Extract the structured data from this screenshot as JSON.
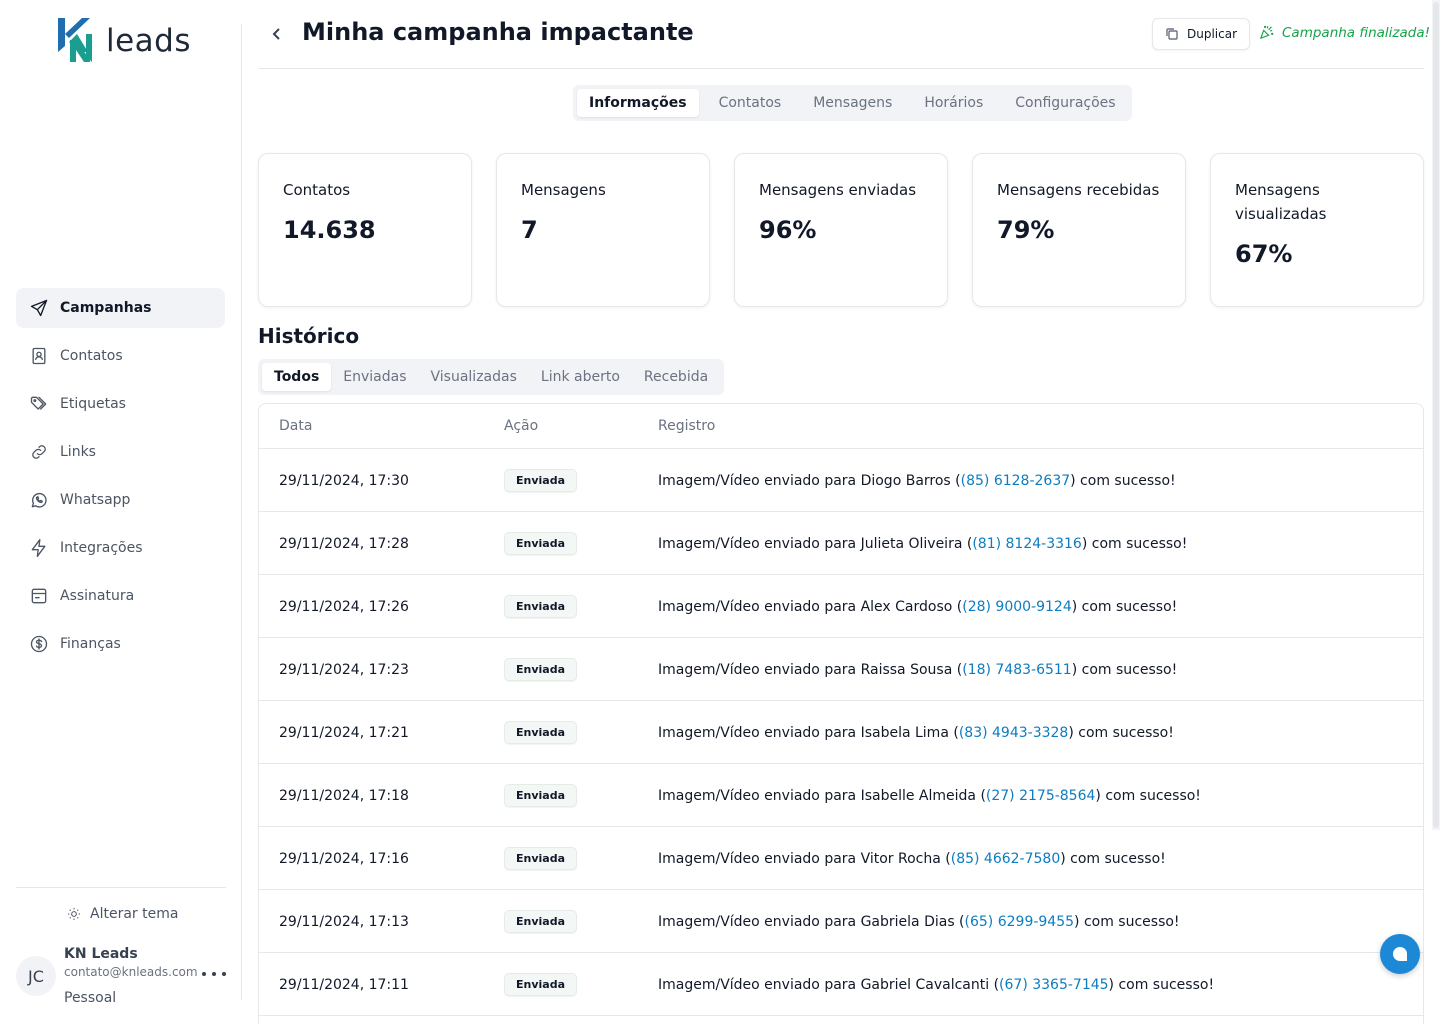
{
  "brand": {
    "logo_text": "leads"
  },
  "sidebar": {
    "items": [
      {
        "label": "Campanhas",
        "icon": "send-icon",
        "active": true
      },
      {
        "label": "Contatos",
        "icon": "contact-book-icon"
      },
      {
        "label": "Etiquetas",
        "icon": "tags-icon"
      },
      {
        "label": "Links",
        "icon": "link-icon"
      },
      {
        "label": "Whatsapp",
        "icon": "whatsapp-icon"
      },
      {
        "label": "Integrações",
        "icon": "zap-icon"
      },
      {
        "label": "Assinatura",
        "icon": "subscription-icon"
      },
      {
        "label": "Finanças",
        "icon": "dollar-icon"
      }
    ],
    "theme_toggle": "Alterar tema",
    "user": {
      "initials": "JC",
      "name": "KN Leads",
      "email": "contato@knleads.com",
      "plan": "Pessoal"
    }
  },
  "header": {
    "title": "Minha campanha impactante",
    "duplicate_label": "Duplicar",
    "status_text": "Campanha finalizada!"
  },
  "tabs": [
    "Informações",
    "Contatos",
    "Mensagens",
    "Horários",
    "Configurações"
  ],
  "stats": [
    {
      "label": "Contatos",
      "value": "14.638"
    },
    {
      "label": "Mensagens",
      "value": "7"
    },
    {
      "label": "Mensagens enviadas",
      "value": "96%"
    },
    {
      "label": "Mensagens recebidas",
      "value": "79%"
    },
    {
      "label": "Mensagens visualizadas",
      "value": "67%"
    }
  ],
  "history": {
    "title": "Histórico",
    "filters": [
      "Todos",
      "Enviadas",
      "Visualizadas",
      "Link aberto",
      "Recebida"
    ],
    "columns": [
      "Data",
      "Ação",
      "Registro"
    ],
    "rows": [
      {
        "date": "29/11/2024, 17:30",
        "action": "Enviada",
        "prefix": "Imagem/Vídeo enviado para Diogo Barros (",
        "phone": "(85) 6128-2637",
        "suffix": ") com sucesso!"
      },
      {
        "date": "29/11/2024, 17:28",
        "action": "Enviada",
        "prefix": "Imagem/Vídeo enviado para Julieta Oliveira (",
        "phone": "(81) 8124-3316",
        "suffix": ") com sucesso!"
      },
      {
        "date": "29/11/2024, 17:26",
        "action": "Enviada",
        "prefix": "Imagem/Vídeo enviado para Alex Cardoso (",
        "phone": "(28) 9000-9124",
        "suffix": ") com sucesso!"
      },
      {
        "date": "29/11/2024, 17:23",
        "action": "Enviada",
        "prefix": "Imagem/Vídeo enviado para Raissa Sousa (",
        "phone": "(18) 7483-6511",
        "suffix": ") com sucesso!"
      },
      {
        "date": "29/11/2024, 17:21",
        "action": "Enviada",
        "prefix": "Imagem/Vídeo enviado para Isabela Lima (",
        "phone": "(83) 4943-3328",
        "suffix": ") com sucesso!"
      },
      {
        "date": "29/11/2024, 17:18",
        "action": "Enviada",
        "prefix": "Imagem/Vídeo enviado para Isabelle Almeida (",
        "phone": "(27) 2175-8564",
        "suffix": ") com sucesso!"
      },
      {
        "date": "29/11/2024, 17:16",
        "action": "Enviada",
        "prefix": "Imagem/Vídeo enviado para Vitor Rocha (",
        "phone": "(85) 4662-7580",
        "suffix": ") com sucesso!"
      },
      {
        "date": "29/11/2024, 17:13",
        "action": "Enviada",
        "prefix": "Imagem/Vídeo enviado para Gabriela Dias (",
        "phone": "(65) 6299-9455",
        "suffix": ") com sucesso!"
      },
      {
        "date": "29/11/2024, 17:11",
        "action": "Enviada",
        "prefix": "Imagem/Vídeo enviado para Gabriel Cavalcanti (",
        "phone": "(67) 3365-7145",
        "suffix": ") com sucesso!"
      }
    ]
  },
  "colors": {
    "accent": "#0d7cc1",
    "success": "#16a34a",
    "chat": "#1d88d6",
    "logo_blue": "#1f6fb0",
    "logo_green": "#1a9e8f"
  }
}
